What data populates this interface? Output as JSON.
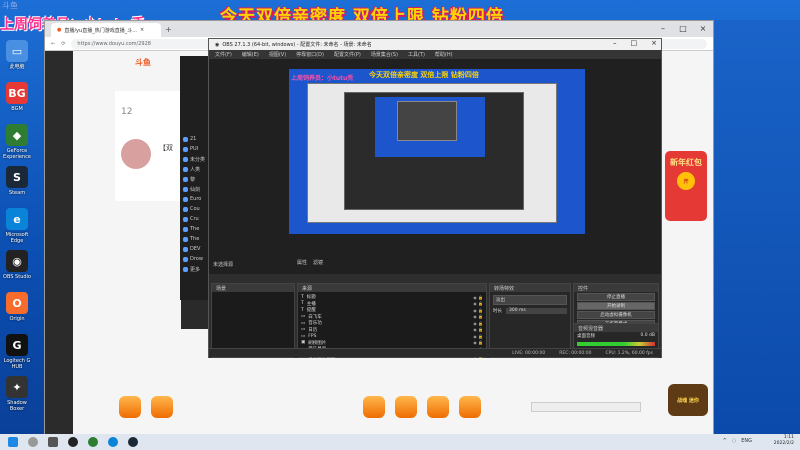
{
  "overlay": {
    "streamer_text": "上周饲养员：小tutu秃",
    "banner_text": "今天双倍亲密度 双倍上限 钻粉四倍",
    "douyu_mark": "斗鱼"
  },
  "desktop_icons": [
    {
      "label": "此电脑",
      "color": "#4a90e2",
      "glyph": "▭"
    },
    {
      "label": "BGM",
      "color": "#e53935",
      "glyph": "BG"
    },
    {
      "label": "GeForce Experience",
      "color": "#2e7d32",
      "glyph": "◆"
    },
    {
      "label": "Steam",
      "color": "#1b2838",
      "glyph": "S"
    },
    {
      "label": "Microsoft Edge",
      "color": "#0a84d8",
      "glyph": "e"
    },
    {
      "label": "OBS Studio",
      "color": "#222222",
      "glyph": "◉"
    },
    {
      "label": "Origin",
      "color": "#f56c2d",
      "glyph": "O"
    },
    {
      "label": "Logitech G HUB",
      "color": "#111111",
      "glyph": "G"
    },
    {
      "label": "Shadow Boxer",
      "color": "#333333",
      "glyph": "✦"
    }
  ],
  "browser": {
    "tab_title": "直播/yu直播_热门游戏直播_斗...",
    "url": "https://www.douyu.com/2928"
  },
  "douyu_page": {
    "logo": "斗鱼",
    "fans_count": "12",
    "room_label": "【双",
    "side_headers": [
      "主页",
      "游戏"
    ],
    "side_items": [
      "21",
      "PUI",
      "未分类",
      "人类",
      "黎",
      "仙剑",
      "Euro",
      "Cou",
      "Cru",
      "The",
      "The",
      "DEV",
      "Drow",
      "更多"
    ],
    "red_packet": "新年红包",
    "red_packet_coin": "开"
  },
  "obs": {
    "title": "OBS 27.1.3 (64-bit, windows) - 配置文件: 未命名 - 场景: 未命名",
    "menu": [
      "文件(F)",
      "编辑(E)",
      "视图(V)",
      "停靠窗口(D)",
      "配置文件(P)",
      "场景集合(S)",
      "工具(T)",
      "帮助(H)"
    ],
    "canvas_text1": "上周饲养员：小tutu秃",
    "canvas_text2": "今天双倍亲密度 双倍上限 钻粉四倍",
    "toolbar": [
      "属性",
      "滤镜"
    ],
    "no_source": "未选择源",
    "docks": {
      "scenes_title": "场景",
      "sources_title": "来源",
      "transitions_title": "转场特效",
      "controls_title": "控件",
      "mixer_title": "音频混音器"
    },
    "sources": [
      "标题",
      "主播",
      "提醒",
      "白飞车",
      "音乐功",
      "日历",
      "FPS",
      "刷榜图片",
      "音乐显示",
      "音乐图示重复"
    ],
    "transition": {
      "type": "淡出",
      "duration_label": "时长",
      "duration": "300 ms"
    },
    "controls": [
      "停止直播",
      "开始录制",
      "启动虚拟摄像机",
      "工作室模式",
      "设置",
      "退出"
    ],
    "mixer_channel": "桌面音频",
    "mixer_db": "0.0 dB",
    "status": {
      "live": "LIVE: 00:00:00",
      "rec": "REC: 00:00:00",
      "cpu": "CPU: 1.2%, 60.00 fps"
    }
  },
  "mascot_text": "战魂 迷你",
  "taskbar": {
    "time": "1:11",
    "date": "2022/2/2",
    "tray": [
      "^",
      "◌",
      "ENG"
    ]
  }
}
